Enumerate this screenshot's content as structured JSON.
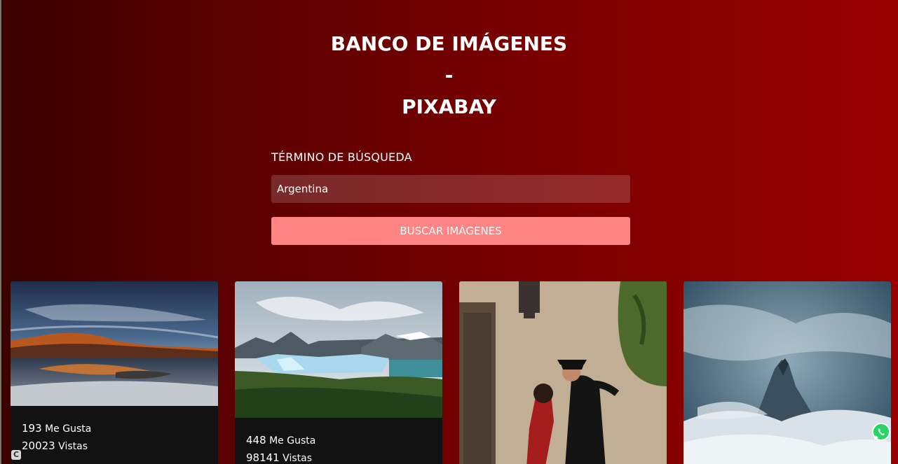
{
  "header": {
    "line1": "BANCO DE IMÁGENES",
    "line2": "-",
    "line3": "PIXABAY"
  },
  "search": {
    "label": "TÉRMINO DE BÚSQUEDA",
    "value": "Argentina",
    "button_label": "BUSCAR IMÁGENES"
  },
  "results": [
    {
      "likes": "193",
      "likes_label": "Me Gusta",
      "views": "20023",
      "views_label": "Vistas"
    },
    {
      "likes": "448",
      "likes_label": "Me Gusta",
      "views": "98141",
      "views_label": "Vistas"
    },
    {
      "likes": "",
      "likes_label": "",
      "views": "",
      "views_label": ""
    },
    {
      "likes": "",
      "likes_label": "",
      "views": "",
      "views_label": ""
    }
  ],
  "icons": {
    "corner": "c-badge-icon",
    "floating": "whatsapp-icon"
  }
}
